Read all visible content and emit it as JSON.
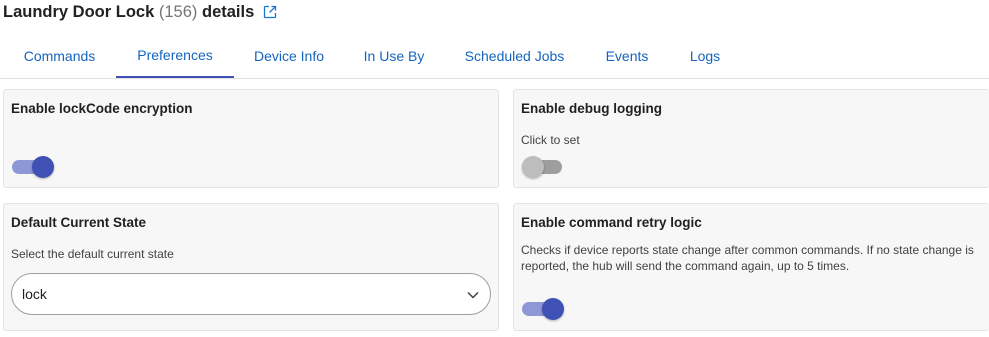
{
  "header": {
    "device_name": "Laundry Door Lock",
    "device_id": "(156)",
    "suffix": "details",
    "external_icon": "external-link-icon"
  },
  "tabs": [
    {
      "label": "Commands"
    },
    {
      "label": "Preferences",
      "active": true
    },
    {
      "label": "Device Info"
    },
    {
      "label": "In Use By"
    },
    {
      "label": "Scheduled Jobs"
    },
    {
      "label": "Events"
    },
    {
      "label": "Logs"
    }
  ],
  "preferences": {
    "lockcode_encryption": {
      "title": "Enable lockCode encryption",
      "enabled": true
    },
    "debug_logging": {
      "title": "Enable debug logging",
      "hint": "Click to set",
      "enabled": false
    },
    "default_state": {
      "title": "Default Current State",
      "hint": "Select the default current state",
      "selected": "lock",
      "icon": "chevron-down-icon"
    },
    "command_retry": {
      "title": "Enable command retry logic",
      "description_line1": "Checks if device reports state change after common commands. If no state change is",
      "description_line2": "reported, the hub will send the command again, up to 5 times.",
      "enabled": true
    }
  },
  "colors": {
    "accent": "#3f51b5",
    "accent_light": "#8e98d6",
    "link": "#1565c0",
    "card_bg": "#f7f7f7"
  }
}
